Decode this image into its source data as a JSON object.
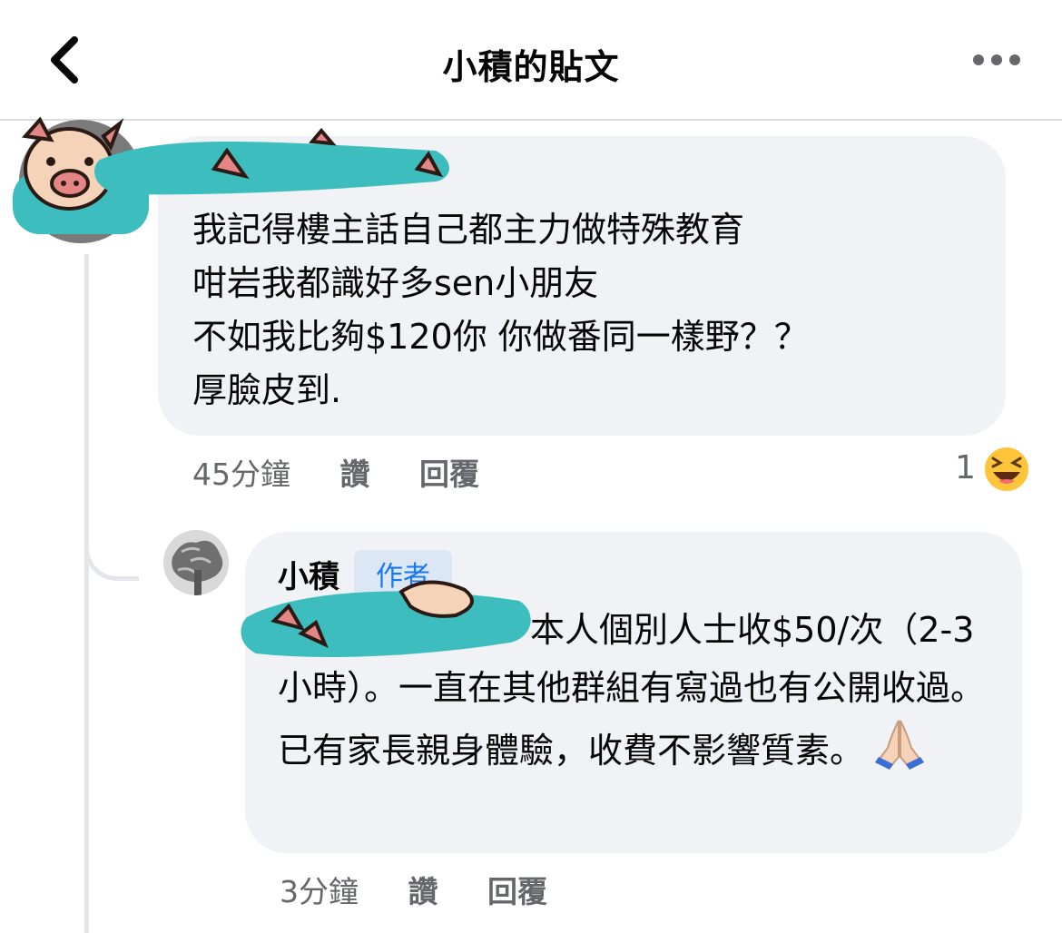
{
  "header": {
    "title": "小積的貼文"
  },
  "comment": {
    "text": "我記得樓主話自己都主力做特殊教育\n咁岩我都識好多sen小朋友\n不如我比夠$120你 你做番同一樣野？？\n厚臉皮到.",
    "time": "45分鐘",
    "like_label": "讚",
    "reply_label": "回覆",
    "reaction_count": "1",
    "reaction_icon": "laughing-emoji"
  },
  "reply": {
    "author": "小積",
    "badge": "作者",
    "text": "本人個別人士收$50/次（2-3小時）。一直在其他群組有寫過也有公開收過。已有家長親身體驗，收費不影響質素。",
    "emoji": "folded-hands",
    "time": "3分鐘",
    "like_label": "讚",
    "reply_label": "回覆"
  },
  "colors": {
    "accent": "#1877f2",
    "bubble": "#f0f2f5",
    "meta": "#65676b",
    "scribble": "#3dbdbd"
  }
}
